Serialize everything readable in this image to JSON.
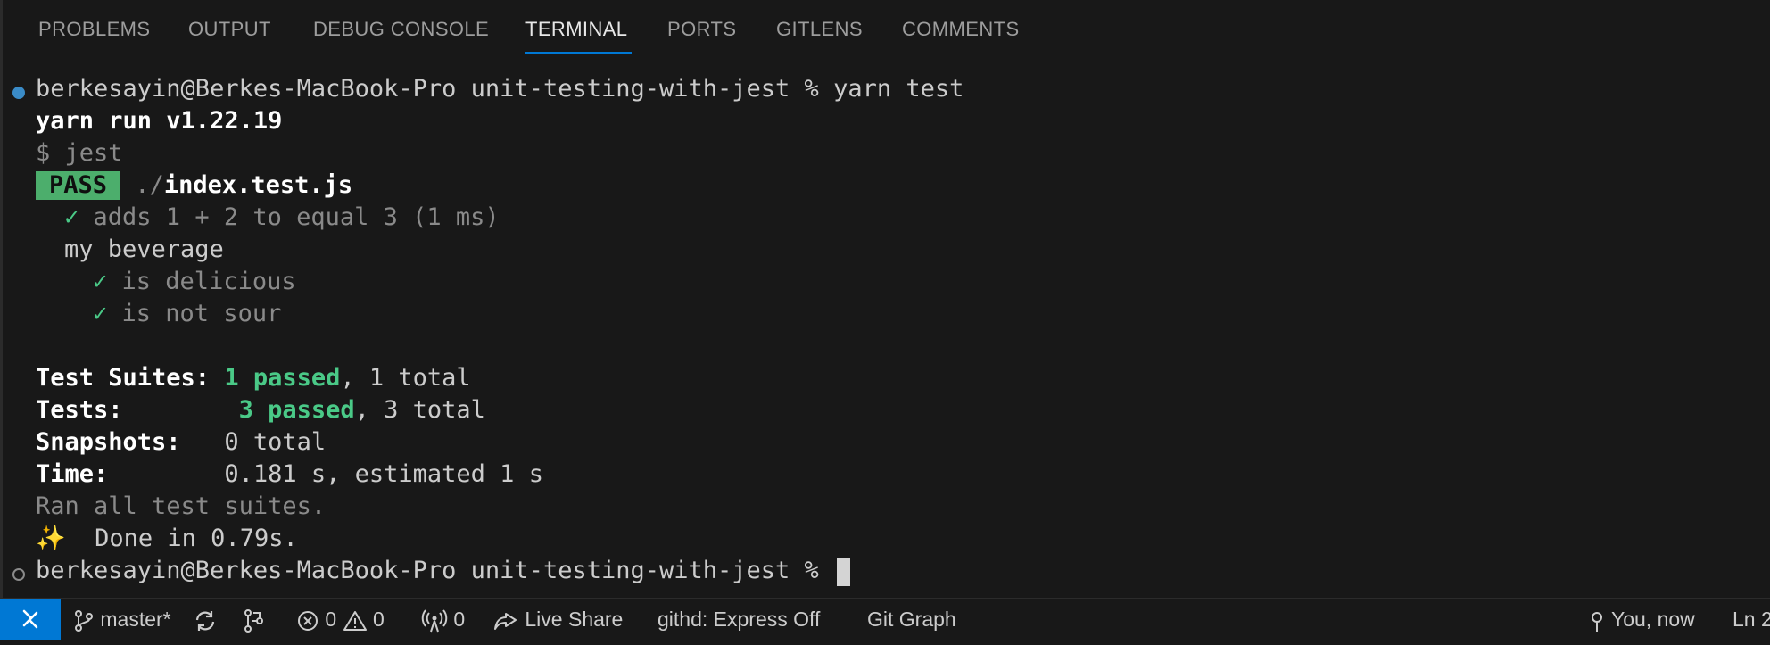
{
  "tabs": [
    "PROBLEMS",
    "OUTPUT",
    "DEBUG CONSOLE",
    "TERMINAL",
    "PORTS",
    "GITLENS",
    "COMMENTS"
  ],
  "active_tab": "TERMINAL",
  "terminal": {
    "prompt": "berkesayin@Berkes-MacBook-Pro unit-testing-with-jest %",
    "command": "yarn test",
    "yarn_version": "yarn run v1.22.19",
    "jest_cmd": "$ jest",
    "pass_badge": "PASS",
    "file_dir": "./",
    "file_name": "index.test.js",
    "check": "✓",
    "test1": "adds 1 + 2 to equal 3 (1 ms)",
    "group": "my beverage",
    "test2": "is delicious",
    "test3": "is not sour",
    "suites_label": "Test Suites:",
    "suites_passed": "1 passed",
    "suites_total": ", 1 total",
    "tests_label": "Tests:",
    "tests_passed": "3 passed",
    "tests_total": ", 3 total",
    "snapshots_label": "Snapshots:",
    "snapshots_value": "0 total",
    "time_label": "Time:",
    "time_value": "0.181 s, estimated 1 s",
    "ran_all": "Ran all test suites.",
    "sparkles": "✨",
    "done": "Done in 0.79s."
  },
  "statusbar": {
    "branch": "master*",
    "errors": "0",
    "warnings": "0",
    "ports": "0",
    "live_share": "Live Share",
    "githd": "githd: Express Off",
    "git_graph": "Git Graph",
    "blame": "You, now",
    "position": "Ln 2"
  },
  "colors": {
    "accent": "#0078d4",
    "pass_bg": "#4cae6c",
    "success_text": "#4ac987",
    "background": "#181818"
  }
}
